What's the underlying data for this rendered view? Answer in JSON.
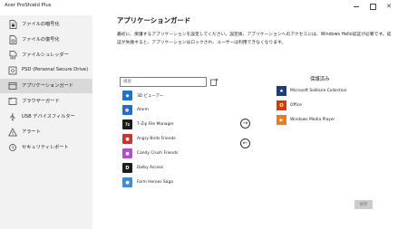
{
  "app": {
    "title": "Acer ProShield Plus"
  },
  "sidebar": {
    "items": [
      {
        "label": "ファイルの暗号化",
        "icon": "file-lock-icon"
      },
      {
        "label": "ファイルの復号化",
        "icon": "file-unlock-icon"
      },
      {
        "label": "ファイルシュレッダー",
        "icon": "file-shredder-icon"
      },
      {
        "label": "PSD (Personal Secure Drive)",
        "icon": "drive-icon"
      },
      {
        "label": "アプリケーションガード",
        "icon": "app-guard-icon"
      },
      {
        "label": "ブラウザーガード",
        "icon": "browser-guard-icon"
      },
      {
        "label": "USB デバイスフィルター",
        "icon": "usb-icon"
      },
      {
        "label": "アラート",
        "icon": "warning-icon"
      },
      {
        "label": "セキュリティレポート",
        "icon": "report-icon"
      }
    ],
    "active_index": 4
  },
  "main": {
    "title": "アプリケーションガード",
    "description": "最初に、保護するアプリケーションを設定してください。設定後、アプリケーションへのアクセスには、Windows Hello認証が必要です。認証が失敗すると、アプリケーションはロックされ、ユーザーは利用できなくなります。",
    "search_placeholder": "検索",
    "left_apps": [
      {
        "name": "3D ビューアー",
        "color": "#1e73c8",
        "glyph": "◆"
      },
      {
        "name": "Alarm",
        "color": "#1a6fd1",
        "glyph": "⏰"
      },
      {
        "name": "7-Zip File Manager",
        "color": "#1c1c1c",
        "glyph": "7z"
      },
      {
        "name": "Angry Birds Friends",
        "color": "#d03232",
        "glyph": "●"
      },
      {
        "name": "Candy Crush Friends",
        "color": "#b04fc8",
        "glyph": "●"
      },
      {
        "name": "Dolby Access",
        "color": "#1c1c1c",
        "glyph": "D"
      },
      {
        "name": "Farm Heroes Saga",
        "color": "#3a8fd8",
        "glyph": "●"
      }
    ],
    "right_title": "保護済み",
    "right_apps": [
      {
        "name": "Microsoft Solitaire Collection",
        "color": "#1c3f7a",
        "glyph": "♠"
      },
      {
        "name": "Office",
        "color": "#d83b01",
        "glyph": "O"
      },
      {
        "name": "Windows Media Player",
        "color": "#e87c1e",
        "glyph": "▶"
      }
    ],
    "save_label": "保存"
  }
}
